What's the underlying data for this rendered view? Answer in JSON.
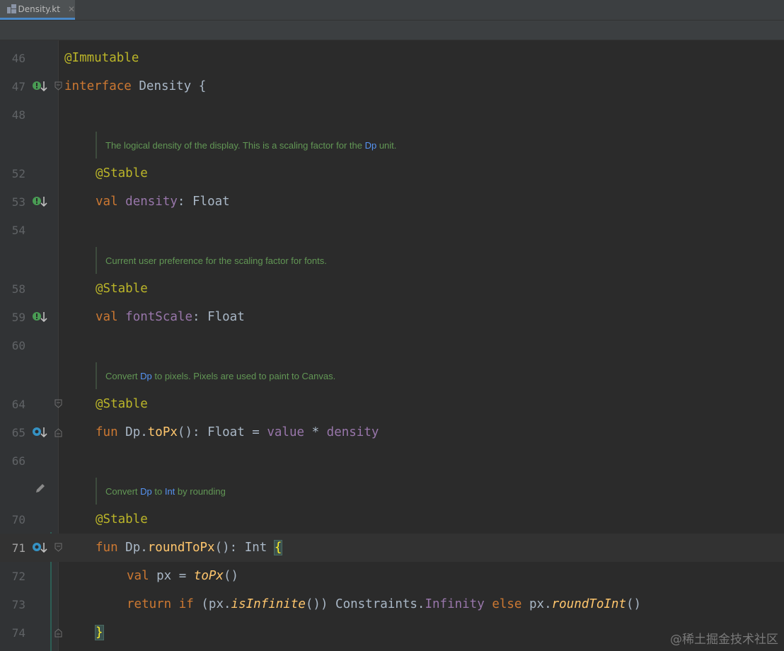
{
  "tab": {
    "filename": "Density.kt",
    "close": "✕"
  },
  "lines": [
    {
      "num": "46",
      "annotation": "@Immutable"
    },
    {
      "num": "47",
      "kw": "interface",
      "name": "Density",
      "brace": "{"
    },
    {
      "num": "48"
    },
    {
      "num": "52",
      "annotation": "@Stable"
    },
    {
      "num": "53",
      "kw": "val",
      "prop": "density",
      "sep": ":",
      "type": "Float"
    },
    {
      "num": "54"
    },
    {
      "num": "58",
      "annotation": "@Stable"
    },
    {
      "num": "59",
      "kw": "val",
      "prop": "fontScale",
      "sep": ":",
      "type": "Float"
    },
    {
      "num": "60"
    },
    {
      "num": "64",
      "annotation": "@Stable"
    },
    {
      "num": "65",
      "kw": "fun",
      "receiver": "Dp.",
      "fn": "toPx",
      "sig": "(): Float = ",
      "value": "value",
      "op": " * ",
      "density": "density"
    },
    {
      "num": "66"
    },
    {
      "num": "70",
      "annotation": "@Stable"
    },
    {
      "num": "71",
      "kw": "fun",
      "receiver": "Dp.",
      "fn": "roundToPx",
      "sig": "(): Int ",
      "brace": "{"
    },
    {
      "num": "72",
      "kw": "val",
      "rest": " px = ",
      "call": "toPx",
      "paren": "()"
    },
    {
      "num": "73",
      "kw1": "return",
      "kw2": "if",
      "a": " (px.",
      "call": "isInfinite",
      "b": "()) Constraints.",
      "infinity": "Infinity",
      "kw3": "else",
      "c": " px.",
      "call2": "roundToInt",
      "d": "()"
    },
    {
      "num": "74",
      "brace": "}"
    }
  ],
  "docs": {
    "d1": {
      "text1": "The logical density of the display. This is a scaling factor for the ",
      "ref1": "Dp",
      "text2": " unit."
    },
    "d2": {
      "text1": "Current user preference for the scaling factor for fonts."
    },
    "d3": {
      "text1": "Convert ",
      "ref1": "Dp",
      "text2": " to pixels. Pixels are used to paint to Canvas."
    },
    "d4": {
      "text1": "Convert ",
      "ref1": "Dp",
      "text2": " to ",
      "ref2": "Int",
      "text3": " by rounding"
    }
  },
  "watermark": "@稀土掘金技术社区",
  "colors": {
    "background": "#2b2b2b",
    "keyword": "#cc7832",
    "annotation": "#bbb529",
    "property": "#9876aa",
    "function": "#ffc66d",
    "doc": "#629755",
    "link": "#5694f2"
  }
}
